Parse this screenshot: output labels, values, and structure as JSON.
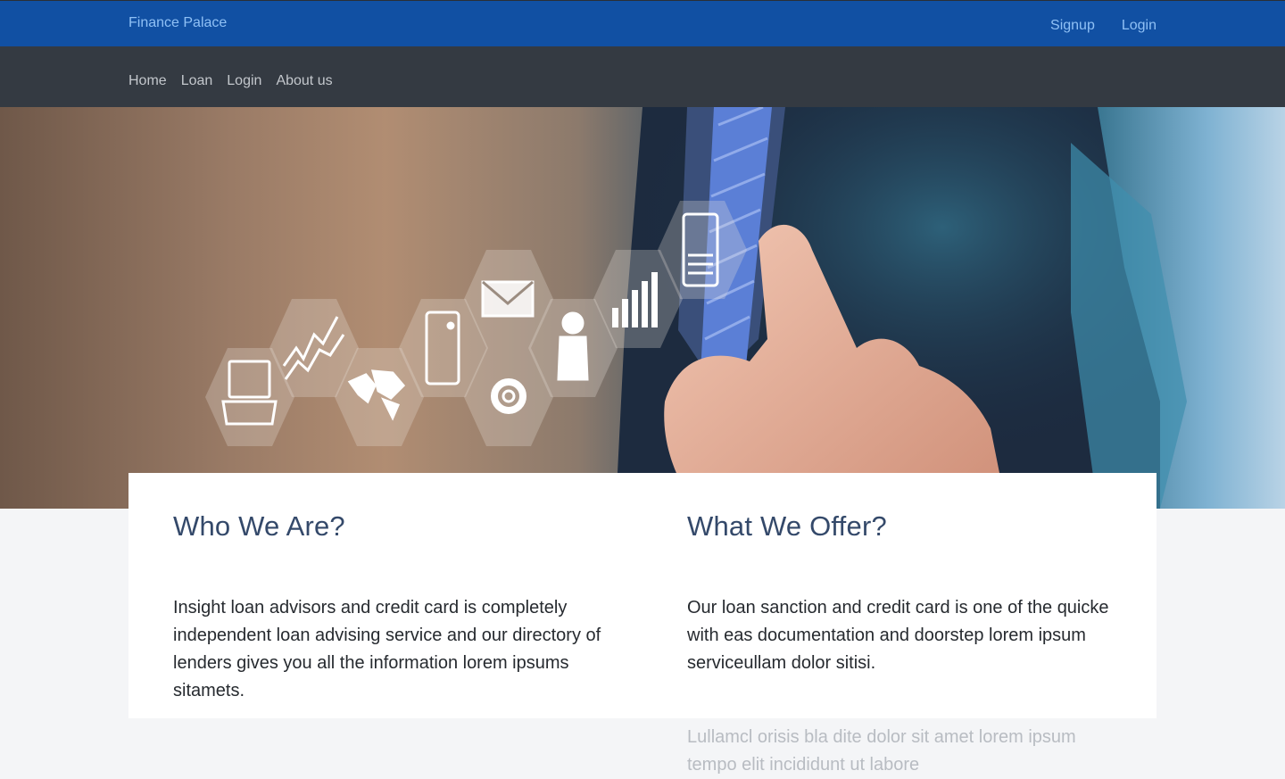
{
  "header": {
    "brand": "Finance Palace",
    "signup": "Signup",
    "login": "Login"
  },
  "nav": {
    "items": [
      "Home",
      "Loan",
      "Login",
      "About us"
    ]
  },
  "hero": {
    "icons": [
      "laptop-icon",
      "chart-line-icon",
      "world-map-icon",
      "tablet-icon",
      "envelope-icon",
      "gear-icon",
      "person-icon",
      "bar-chart-icon",
      "mobile-icon"
    ]
  },
  "sections": {
    "who": {
      "title": "Who We Are?",
      "text": "Insight loan advisors and credit card is completely independent loan advising service and our directory of lenders gives you all the information lorem ipsums sitamets."
    },
    "what": {
      "title": "What We Offer?",
      "text": "Our loan sanction and credit card is one of the quicke with eas documentation and doorstep lorem ipsum serviceullam dolor sitisi.",
      "text2": "Lullamcl orisis bla dite dolor sit amet lorem ipsum tempo elit incididunt ut labore"
    }
  },
  "colors": {
    "topbar": "#1150a3",
    "navbar": "#343a42",
    "heading": "#34496a",
    "link": "#8fc0f5"
  }
}
